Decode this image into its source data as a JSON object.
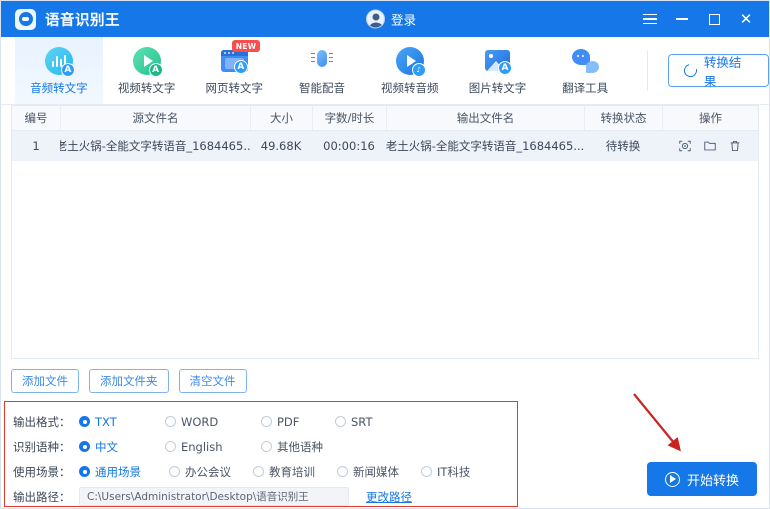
{
  "titlebar": {
    "app_title": "语音识别王",
    "login_label": "登录",
    "logo_icon": "app-logo-icon",
    "avatar_icon": "avatar-icon",
    "menu_icon": "hamburger-menu-icon",
    "minimize_icon": "minimize-icon",
    "maximize_icon": "maximize-icon",
    "close_icon": "close-icon",
    "close_glyph": "✕",
    "accent_color": "#1577e8"
  },
  "tabs": [
    {
      "label": "音频转文字",
      "icon": "audio-to-text-icon",
      "active": true,
      "badge": ""
    },
    {
      "label": "视频转文字",
      "icon": "video-to-text-icon",
      "active": false,
      "badge": ""
    },
    {
      "label": "网页转文字",
      "icon": "webpage-to-text-icon",
      "active": false,
      "badge": "NEW"
    },
    {
      "label": "智能配音",
      "icon": "smart-dubbing-icon",
      "active": false,
      "badge": ""
    },
    {
      "label": "视频转音频",
      "icon": "video-to-audio-icon",
      "active": false,
      "badge": ""
    },
    {
      "label": "图片转文字",
      "icon": "image-to-text-icon",
      "active": false,
      "badge": ""
    },
    {
      "label": "翻译工具",
      "icon": "translate-tool-icon",
      "active": false,
      "badge": ""
    }
  ],
  "result_button": {
    "label": "转换结果",
    "icon": "refresh-icon"
  },
  "table": {
    "headers": {
      "no": "编号",
      "source_name": "源文件名",
      "size": "大小",
      "duration": "字数/时长",
      "output_name": "输出文件名",
      "status": "转换状态",
      "actions": "操作"
    },
    "rows": [
      {
        "no": "1",
        "source_name": "老土火锅-全能文字转语音_1684465...",
        "size": "49.68K",
        "duration": "00:00:16",
        "output_name": "老土火锅-全能文字转语音_1684465...",
        "status": "待转换",
        "action_icons": [
          "preview-icon",
          "open-folder-icon",
          "delete-icon"
        ]
      }
    ]
  },
  "table_actions": {
    "add_file": "添加文件",
    "add_folder": "添加文件夹",
    "clear_files": "清空文件"
  },
  "settings": {
    "output_format": {
      "label": "输出格式：",
      "options": [
        "TXT",
        "WORD",
        "PDF",
        "SRT"
      ],
      "selected": "TXT"
    },
    "language": {
      "label": "识别语种：",
      "options": [
        "中文",
        "English",
        "其他语种"
      ],
      "selected": "中文"
    },
    "scene": {
      "label": "使用场景：",
      "options": [
        "通用场景",
        "办公会议",
        "教育培训",
        "新闻媒体",
        "IT科技"
      ],
      "selected": "通用场景"
    },
    "output_path": {
      "label": "输出路径：",
      "value": "C:\\Users\\Administrator\\Desktop\\语音识别王",
      "change_link": "更改路径"
    },
    "highlight_color": "#e03b2f"
  },
  "start_button": {
    "label": "开始转换",
    "icon": "play-circle-icon"
  },
  "annotation": {
    "arrow_icon": "red-arrow-icon",
    "color": "#cc2222"
  }
}
